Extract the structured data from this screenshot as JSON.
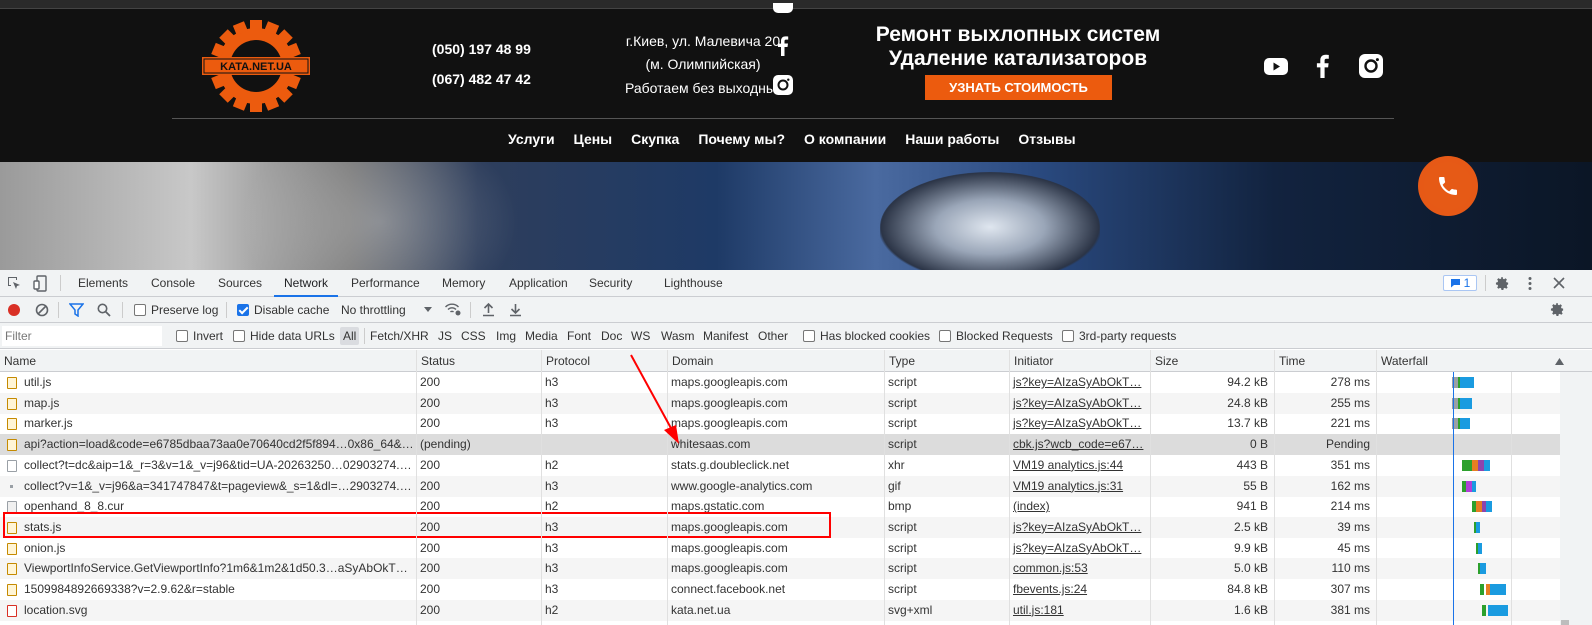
{
  "site": {
    "logo_text": "KATA.NET.UA",
    "phones": [
      "(050) 197 48 99",
      "(067) 482 47 42"
    ],
    "address_lines": [
      "г.Киев, ул. Малевича 20",
      "(м. Олимпийская)",
      "Работаем без выходных"
    ],
    "slogan_line1": "Ремонт выхлопных систем",
    "slogan_line2": "Удаление катализаторов",
    "cta_label": "УЗНАТЬ СТОИМОСТЬ",
    "nav": [
      "Услуги",
      "Цены",
      "Скупка",
      "Почему мы?",
      "О компании",
      "Наши работы",
      "Отзывы"
    ],
    "social_icons": [
      "youtube-icon",
      "facebook-icon",
      "instagram-icon"
    ],
    "accent_color": "#ec5b0e"
  },
  "devtools": {
    "tabs": [
      "Elements",
      "Console",
      "Sources",
      "Network",
      "Performance",
      "Memory",
      "Application",
      "Security",
      "Lighthouse"
    ],
    "active_tab": "Network",
    "issues_badge": "1",
    "toolbar": {
      "preserve_log": "Preserve log",
      "disable_cache": "Disable cache",
      "throttling": "No throttling"
    },
    "filter": {
      "placeholder": "Filter",
      "invert": "Invert",
      "hide_data_urls": "Hide data URLs",
      "types": [
        "All",
        "Fetch/XHR",
        "JS",
        "CSS",
        "Img",
        "Media",
        "Font",
        "Doc",
        "WS",
        "Wasm",
        "Manifest",
        "Other"
      ],
      "has_blocked_cookies": "Has blocked cookies",
      "blocked_requests": "Blocked Requests",
      "third_party": "3rd-party requests"
    },
    "columns": [
      "Name",
      "Status",
      "Protocol",
      "Domain",
      "Type",
      "Initiator",
      "Size",
      "Time",
      "Waterfall"
    ],
    "rows": [
      {
        "name": "util.js",
        "status": "200",
        "protocol": "h3",
        "domain": "maps.googleapis.com",
        "type": "script",
        "initiator": "js?key=AIzaSyAbOkT…",
        "size": "94.2 kB",
        "time": "278 ms"
      },
      {
        "name": "map.js",
        "status": "200",
        "protocol": "h3",
        "domain": "maps.googleapis.com",
        "type": "script",
        "initiator": "js?key=AIzaSyAbOkT…",
        "size": "24.8 kB",
        "time": "255 ms"
      },
      {
        "name": "marker.js",
        "status": "200",
        "protocol": "h3",
        "domain": "maps.googleapis.com",
        "type": "script",
        "initiator": "js?key=AIzaSyAbOkT…",
        "size": "13.7 kB",
        "time": "221 ms"
      },
      {
        "name": "api?action=load&code=e6785dbaa73aa0e70640cd2f5f894…0x86_64&…",
        "status": "(pending)",
        "protocol": "",
        "domain": "whitesaas.com",
        "type": "script",
        "initiator": "cbk.js?wcb_code=e67…",
        "size": "0 B",
        "time": "Pending"
      },
      {
        "name": "collect?t=dc&aip=1&_r=3&v=1&_v=j96&tid=UA-20263250…02903274.…",
        "status": "200",
        "protocol": "h2",
        "domain": "stats.g.doubleclick.net",
        "type": "xhr",
        "initiator": "VM19 analytics.js:44",
        "size": "443 B",
        "time": "351 ms"
      },
      {
        "name": "collect?v=1&_v=j96&a=341747847&t=pageview&_s=1&dl=…2903274.…",
        "status": "200",
        "protocol": "h3",
        "domain": "www.google-analytics.com",
        "type": "gif",
        "initiator": "VM19 analytics.js:31",
        "size": "55 B",
        "time": "162 ms"
      },
      {
        "name": "openhand_8_8.cur",
        "status": "200",
        "protocol": "h2",
        "domain": "maps.gstatic.com",
        "type": "bmp",
        "initiator": "(index)",
        "size": "941 B",
        "time": "214 ms"
      },
      {
        "name": "stats.js",
        "status": "200",
        "protocol": "h3",
        "domain": "maps.googleapis.com",
        "type": "script",
        "initiator": "js?key=AIzaSyAbOkT…",
        "size": "2.5 kB",
        "time": "39 ms"
      },
      {
        "name": "onion.js",
        "status": "200",
        "protocol": "h3",
        "domain": "maps.googleapis.com",
        "type": "script",
        "initiator": "js?key=AIzaSyAbOkT…",
        "size": "9.9 kB",
        "time": "45 ms"
      },
      {
        "name": "ViewportInfoService.GetViewportInfo?1m6&1m2&1d50.3…aSyAbOkTF…",
        "status": "200",
        "protocol": "h3",
        "domain": "maps.googleapis.com",
        "type": "script",
        "initiator": "common.js:53",
        "size": "5.0 kB",
        "time": "110 ms"
      },
      {
        "name": "1509984892669338?v=2.9.62&r=stable",
        "status": "200",
        "protocol": "h3",
        "domain": "connect.facebook.net",
        "type": "script",
        "initiator": "fbevents.js:24",
        "size": "84.8 kB",
        "time": "307 ms"
      },
      {
        "name": "location.svg",
        "status": "200",
        "protocol": "h2",
        "domain": "kata.net.ua",
        "type": "svg+xml",
        "initiator": "util.js:181",
        "size": "1.6 kB",
        "time": "381 ms"
      }
    ]
  }
}
